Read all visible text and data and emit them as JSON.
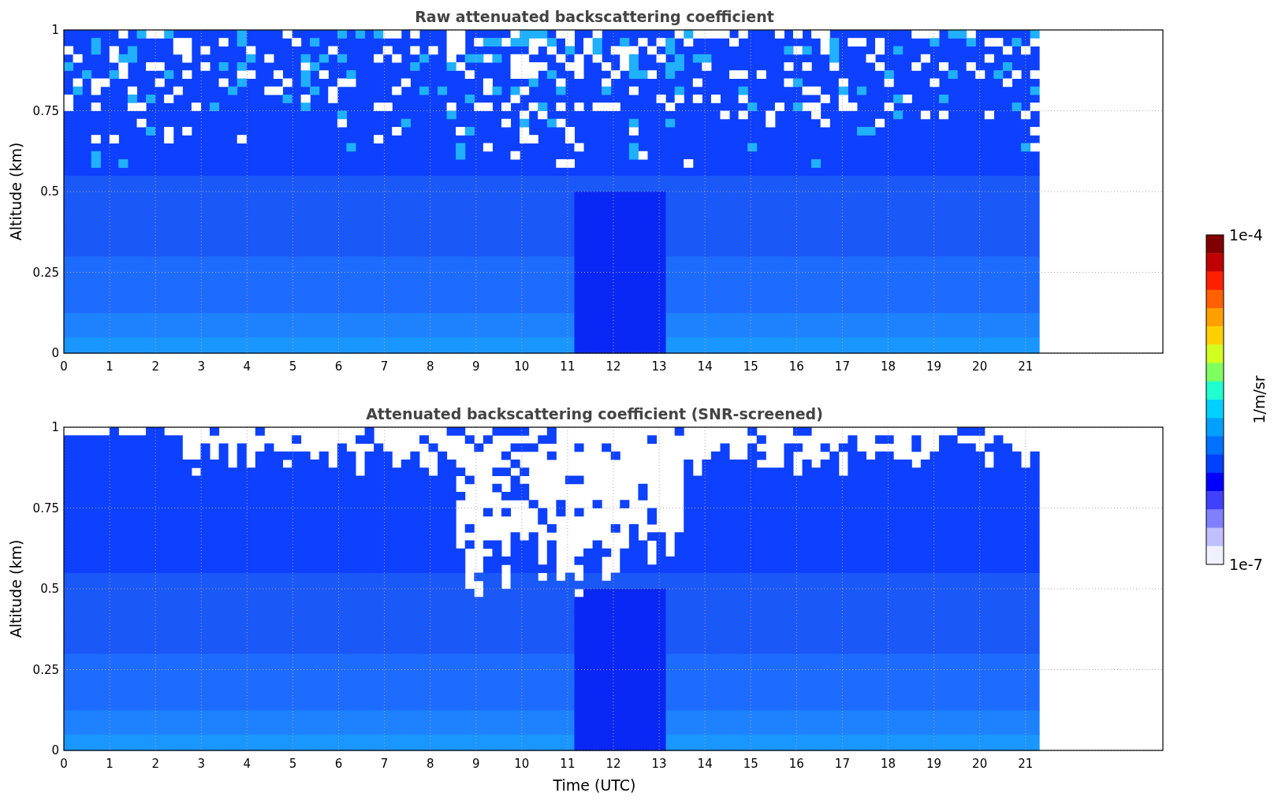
{
  "panels": [
    {
      "kind": "raw",
      "title": "Raw attenuated backscattering coefficient",
      "ylabel": "Altitude (km)",
      "yticks": [
        "1",
        "0.75",
        "0.5",
        "0.25",
        "0"
      ],
      "xticks": [
        "0",
        "1",
        "2",
        "3",
        "4",
        "5",
        "6",
        "7",
        "8",
        "9",
        "10",
        "11",
        "12",
        "13",
        "14",
        "15",
        "16",
        "17",
        "18",
        "19",
        "20",
        "21"
      ]
    },
    {
      "kind": "screened",
      "title": "Attenuated backscattering coefficient (SNR-screened)",
      "ylabel": "Altitude (km)",
      "yticks": [
        "1",
        "0.75",
        "0.5",
        "0.25",
        "0"
      ],
      "xticks": [
        "0",
        "1",
        "2",
        "3",
        "4",
        "5",
        "6",
        "7",
        "8",
        "9",
        "10",
        "11",
        "12",
        "13",
        "14",
        "15",
        "16",
        "17",
        "18",
        "19",
        "20",
        "21"
      ],
      "xlabel": "Time (UTC)"
    }
  ],
  "colorbar": {
    "max": "1e-4",
    "min": "1e-7",
    "label": "1/m/sr"
  }
}
